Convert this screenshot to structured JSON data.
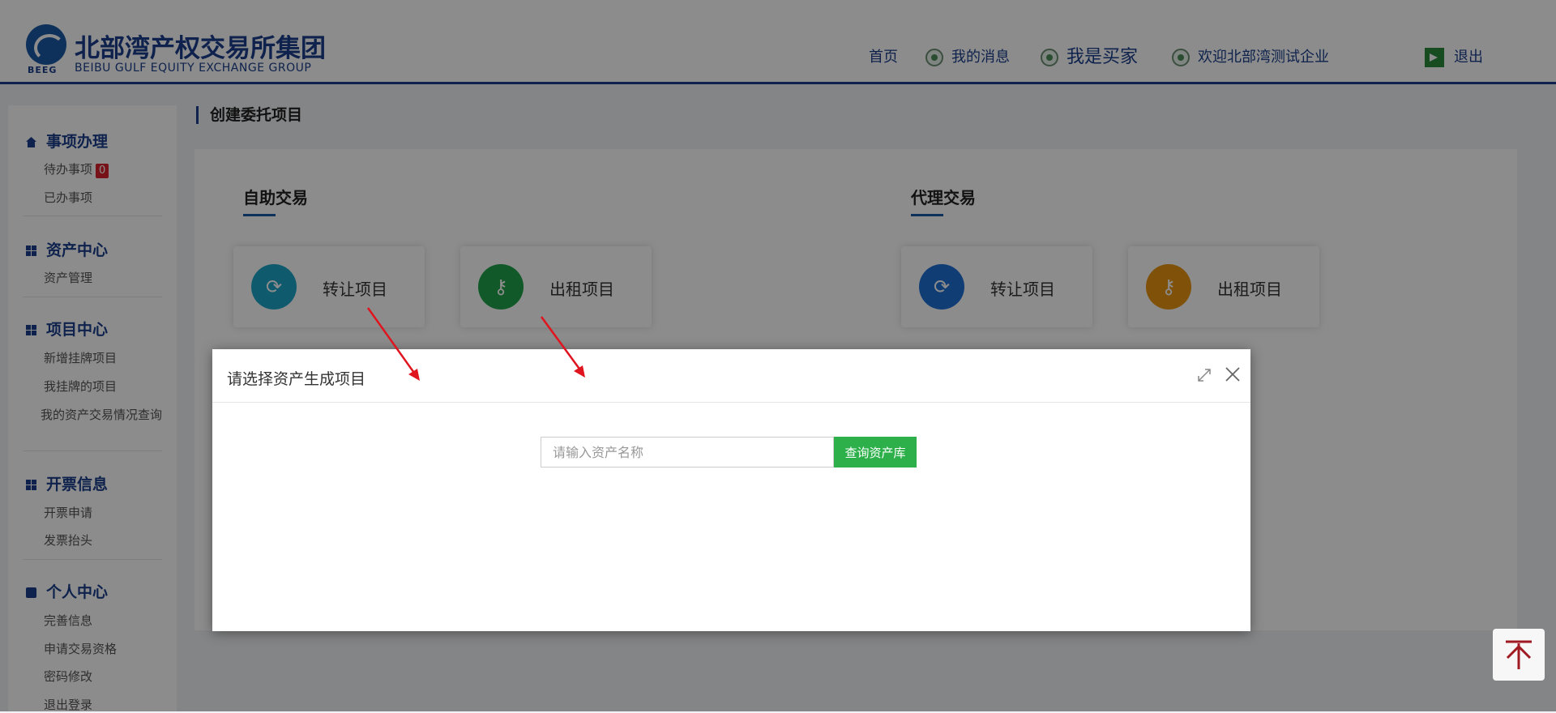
{
  "header": {
    "logo_abbr": "BEEG",
    "logo_cn": "北部湾产权交易所集团",
    "logo_en": "BEIBU GULF EQUITY EXCHANGE GROUP",
    "nav": {
      "home": "首页",
      "messages": "我的消息",
      "buyer": "我是买家",
      "welcome": "欢迎北部湾测试企业",
      "logout": "退出"
    }
  },
  "sidebar": {
    "sections": [
      {
        "title": "事项办理",
        "icon": "home-icon",
        "items": [
          "待办事项",
          "已办事项"
        ]
      },
      {
        "title": "资产中心",
        "icon": "grid-icon",
        "items": [
          "资产管理"
        ]
      },
      {
        "title": "项目中心",
        "icon": "grid-icon",
        "items": [
          "新增挂牌项目",
          "我挂牌的项目",
          "我的资产交易情况查询"
        ]
      },
      {
        "title": "开票信息",
        "icon": "grid-icon",
        "items": [
          "开票申请",
          "发票抬头"
        ]
      },
      {
        "title": "个人中心",
        "icon": "id-card-icon",
        "items": [
          "完善信息",
          "申请交易资格",
          "密码修改",
          "退出登录"
        ]
      }
    ],
    "todo_badge": "0"
  },
  "main": {
    "page_title": "创建委托项目",
    "self_trade": {
      "title": "自助交易",
      "tiles": [
        {
          "label": "转让项目",
          "icon": "refresh-icon",
          "color": "#1ea4c9"
        },
        {
          "label": "出租项目",
          "icon": "key-icon",
          "color": "#1fa34a"
        }
      ]
    },
    "agent_trade": {
      "title": "代理交易",
      "tiles": [
        {
          "label": "转让项目",
          "icon": "refresh-icon",
          "color": "#1f6fd6"
        },
        {
          "label": "出租项目",
          "icon": "key-icon",
          "color": "#e89412"
        }
      ]
    }
  },
  "modal": {
    "title": "请选择资产生成项目",
    "search_placeholder": "请输入资产名称",
    "query_button": "查询资产库"
  },
  "colors": {
    "brand": "#1b3f8c",
    "accent_green": "#2db04a",
    "badge_red": "#d9242c",
    "annotation_arrow": "#e0141e"
  }
}
